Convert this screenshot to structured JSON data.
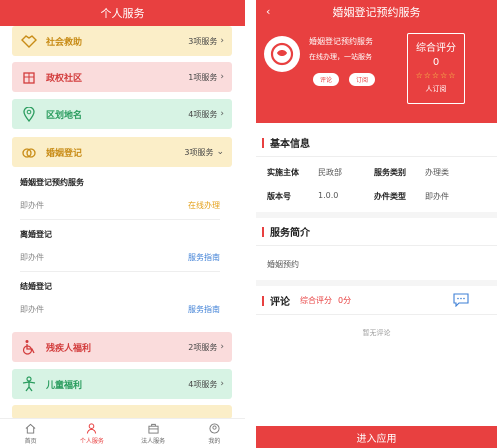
{
  "left": {
    "title": "个人服务",
    "categories": [
      {
        "name": "社会救助",
        "count": "3项服务",
        "arrow": "›",
        "icon": "handshake-icon"
      },
      {
        "name": "政权社区",
        "count": "1项服务",
        "arrow": "›",
        "icon": "building-icon"
      },
      {
        "name": "区划地名",
        "count": "4项服务",
        "arrow": "›",
        "icon": "map-pin-icon"
      },
      {
        "name": "婚姻登记",
        "count": "3项服务",
        "arrow": "⌄",
        "icon": "rings-icon"
      },
      {
        "name": "残疾人福利",
        "count": "2项服务",
        "arrow": "›",
        "icon": "wheelchair-icon"
      },
      {
        "name": "儿童福利",
        "count": "4项服务",
        "arrow": "›",
        "icon": "child-icon"
      }
    ],
    "services": [
      {
        "name": "婚姻登记预约服务",
        "type": "即办件",
        "action": "在线办理"
      },
      {
        "name": "离婚登记",
        "type": "即办件",
        "action": "服务指南"
      },
      {
        "name": "结婚登记",
        "type": "即办件",
        "action": "服务指南"
      }
    ],
    "nav": [
      {
        "label": "首页",
        "icon": "home-icon"
      },
      {
        "label": "个人服务",
        "icon": "person-icon"
      },
      {
        "label": "法人服务",
        "icon": "briefcase-icon"
      },
      {
        "label": "我的",
        "icon": "profile-icon"
      }
    ],
    "active_nav": "个人服务"
  },
  "right": {
    "title": "婚姻登记预约服务",
    "back": "‹",
    "service_name": "婚姻登记预约服务",
    "service_desc": "在线办理，一站服务",
    "evaluate_button": "评论",
    "subscribe_button": "订阅",
    "score_title": "综合评分",
    "score_value": "0",
    "stars": "☆☆☆☆☆",
    "subscribers": "人订阅",
    "basic_info_title": "基本信息",
    "basic_info": {
      "subject_label": "实施主体",
      "subject_value": "民政部",
      "category_label": "服务类别",
      "category_value": "办理类",
      "version_label": "版本号",
      "version_value": "1.0.0",
      "itemtype_label": "办件类型",
      "itemtype_value": "即办件"
    },
    "intro_title": "服务简介",
    "intro_text": "婚姻预约",
    "comment_title": "评论",
    "comment_score_label": "综合评分",
    "comment_score_value": "0分",
    "no_comment": "暂无评论",
    "enter_button": "进入应用"
  },
  "colors": {
    "brand_red": "#e84040",
    "yellow_bg": "#fbeec8",
    "pink_bg": "#fadcdc",
    "green_bg": "#d7f3e4",
    "link_blue": "#3d7fd6",
    "link_yellow": "#e4a11b"
  }
}
